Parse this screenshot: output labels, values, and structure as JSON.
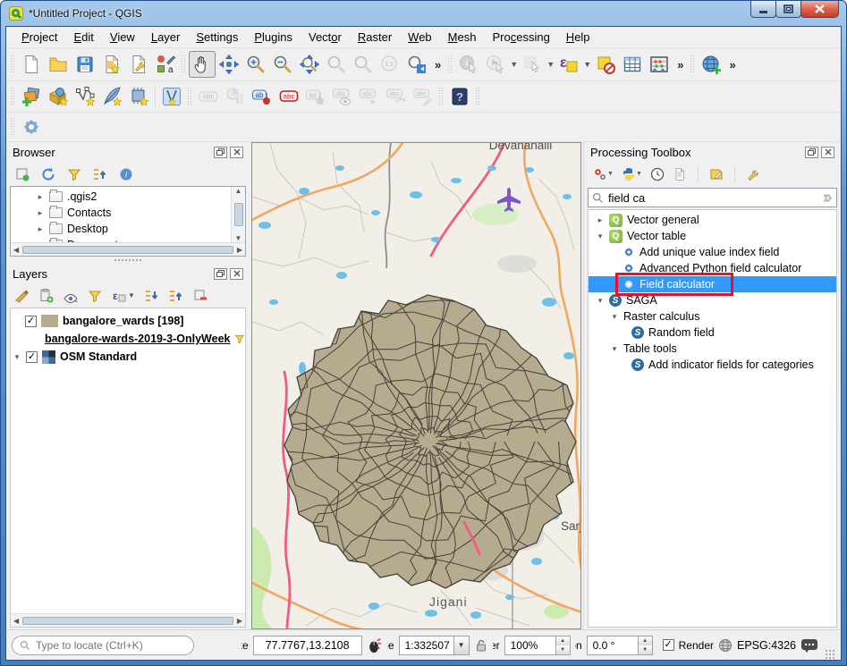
{
  "window": {
    "title": "*Untitled Project - QGIS"
  },
  "menu": {
    "items": [
      {
        "pre": "",
        "key": "P",
        "post": "roject"
      },
      {
        "pre": "",
        "key": "E",
        "post": "dit"
      },
      {
        "pre": "",
        "key": "V",
        "post": "iew"
      },
      {
        "pre": "",
        "key": "L",
        "post": "ayer"
      },
      {
        "pre": "",
        "key": "S",
        "post": "ettings"
      },
      {
        "pre": "",
        "key": "P",
        "post": "lugins"
      },
      {
        "pre": "Vect",
        "key": "o",
        "post": "r"
      },
      {
        "pre": "",
        "key": "R",
        "post": "aster"
      },
      {
        "pre": "",
        "key": "W",
        "post": "eb"
      },
      {
        "pre": "",
        "key": "M",
        "post": "esh"
      },
      {
        "pre": "Pro",
        "key": "c",
        "post": "essing"
      },
      {
        "pre": "",
        "key": "H",
        "post": "elp"
      }
    ]
  },
  "toolbar": {
    "overflow_label": "»"
  },
  "glyphs": {
    "help": "?",
    "epsilon": "ε",
    "abc": "abc",
    "ab": "ab",
    "one_to_one": "1:1",
    "q": "Q",
    "s": "S",
    "check": "✓",
    "info": "i"
  },
  "browser": {
    "title": "Browser",
    "items": [
      ".qgis2",
      "Contacts",
      "Desktop",
      "Documents"
    ]
  },
  "layers": {
    "title": "Layers",
    "rows": [
      {
        "label": "bangalore_wards [198]"
      },
      {
        "label": "bangalore-wards-2019-3-OnlyWeek"
      },
      {
        "label": "OSM Standard"
      }
    ]
  },
  "processing": {
    "title": "Processing Toolbox",
    "search": "field ca",
    "tree": [
      {
        "label": "Vector general"
      },
      {
        "label": "Vector table"
      },
      {
        "label": "Add unique value index field"
      },
      {
        "label": "Advanced Python field calculator"
      },
      {
        "label": "Field calculator",
        "selected": true
      },
      {
        "label": "SAGA"
      },
      {
        "label": "Raster calculus"
      },
      {
        "label": "Random field"
      },
      {
        "label": "Table tools"
      },
      {
        "label": "Add indicator fields for categories"
      }
    ]
  },
  "map": {
    "labels": {
      "town_top": "Devanahalli",
      "town_right": "Sarj",
      "town_bottom": "Jigani"
    }
  },
  "statusbar": {
    "locate_placeholder": "Type to locate (Ctrl+K)",
    "coordinate_label": "Coordinate",
    "coordinate": "77.7767,13.2108",
    "scale_label": "Scale",
    "scale": "1:332507",
    "magnifier_label": "Magnifier",
    "magnifier": "100%",
    "rotation_label": "Rotation",
    "rotation": "0.0 °",
    "render_label": "Render",
    "crs": "EPSG:4326"
  },
  "colors": {
    "selection": "#3399ff",
    "ward_fill": "#b6ab8f",
    "annotation_red": "#e8112d"
  }
}
